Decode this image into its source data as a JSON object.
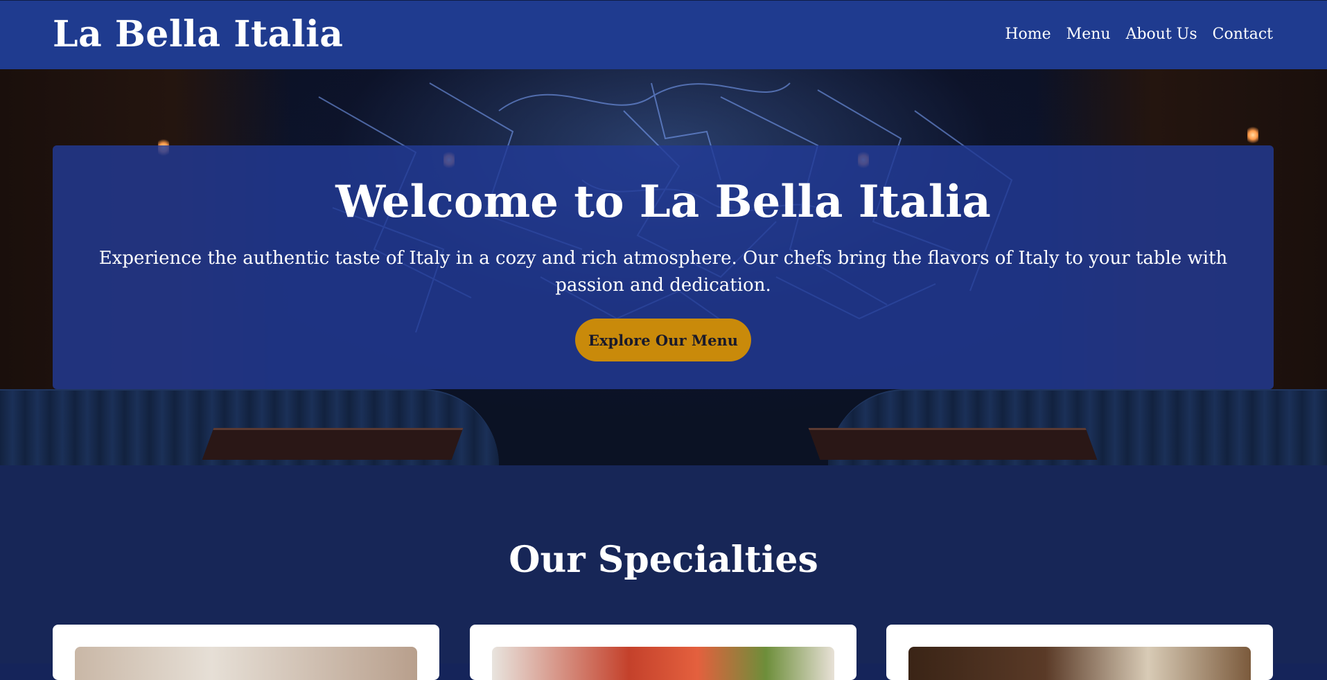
{
  "header": {
    "logo": "La Bella Italia",
    "nav": [
      {
        "label": "Home"
      },
      {
        "label": "Menu"
      },
      {
        "label": "About Us"
      },
      {
        "label": "Contact"
      }
    ]
  },
  "hero": {
    "title": "Welcome to La Bella Italia",
    "text": "Experience the authentic taste of Italy in a cozy and rich atmosphere. Our chefs bring the flavors of Italy to your table with passion and dedication.",
    "button_label": "Explore Our Menu"
  },
  "specialties": {
    "title": "Our Specialties"
  },
  "colors": {
    "header_bg": "#1f3b8f",
    "panel_bg": "#223a96",
    "accent": "#c98a0a",
    "section_bg": "#172657"
  }
}
